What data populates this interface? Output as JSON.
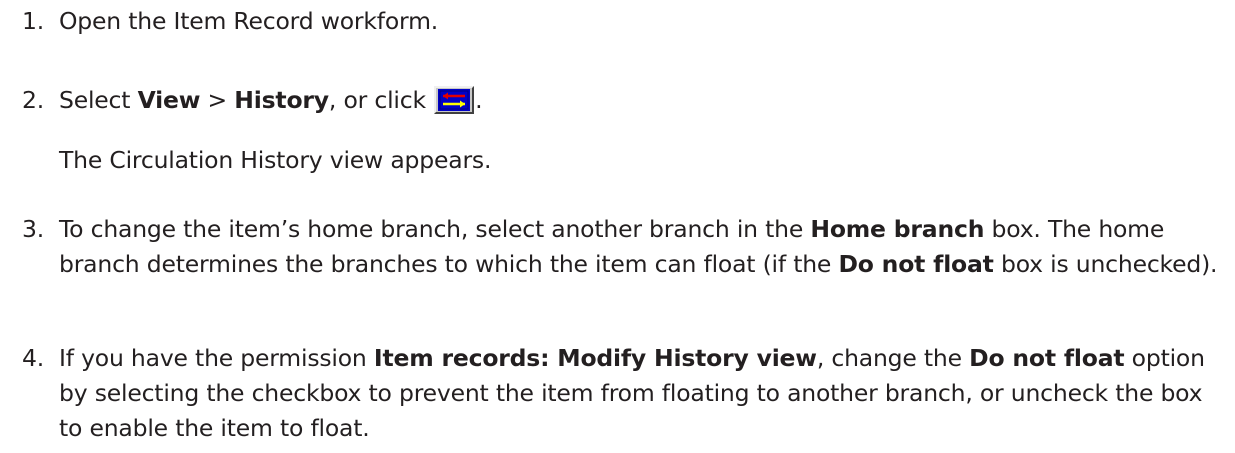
{
  "steps": [
    {
      "number": "1.",
      "text": "Open the Item Record workform."
    },
    {
      "number": "2.",
      "pre": "Select ",
      "view_bold": "View",
      "sep": " > ",
      "history_bold": "History",
      "post_btn_pre": ", or click ",
      "post_btn_post": ".",
      "icon": "history-view-button-icon",
      "result": "The Circulation History view appears."
    },
    {
      "number": "3.",
      "part1": "To change the item’s home branch, select another branch in the ",
      "home_branch_bold": "Home branch",
      "part2": " box. The home branch determines the branches to which the item can float (if the ",
      "do_not_float_bold": "Do not float",
      "part3": " box is unchecked)."
    },
    {
      "number": "4.",
      "part1": " If you have the permission ",
      "permission_bold": "Item records: Modify History view",
      "part2": ", change the ",
      "do_not_float_bold": "Do not float",
      "part3": " option by selecting the checkbox to prevent the item from floating to another branch, or uncheck the box to enable the item to float."
    }
  ],
  "colors": {
    "text": "#231f20",
    "button_face": "#c8c8c8",
    "icon_blue": "#0000c8",
    "icon_red": "#e00000",
    "icon_yellow": "#ffff00"
  }
}
